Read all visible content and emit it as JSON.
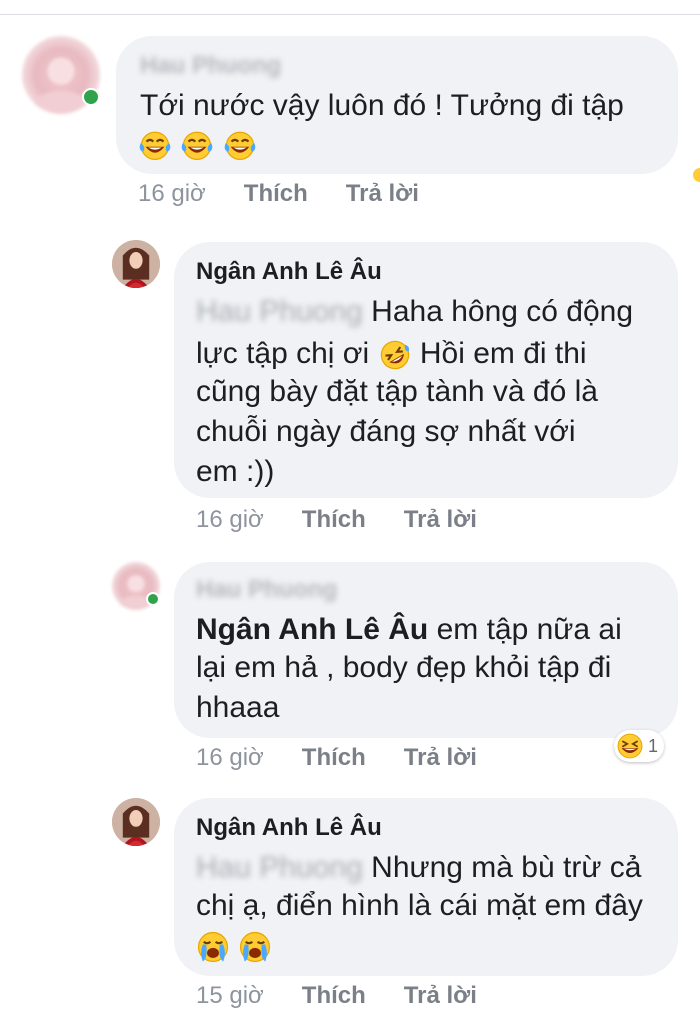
{
  "comments": [
    {
      "author": "Hau Phuong",
      "author_blurred": true,
      "lines": [
        "Tới nước vậy luôn đó ! Tưởng đi tập"
      ],
      "emoji_row": [
        "laughing-tears",
        "laughing-tears",
        "laughing-tears"
      ],
      "time": "16 giờ",
      "like": "Thích",
      "reply": "Trả lời"
    },
    {
      "author": "Ngân Anh Lê Âu",
      "tag": "Hau Phuong",
      "lines": [
        "Haha hông có động",
        "lực tập chị ơi",
        "Hồi em đi thi",
        "cũng bày đặt tập tành và đó là",
        "chuỗi ngày đáng sợ nhất với",
        "em :))"
      ],
      "time": "16 giờ",
      "like": "Thích",
      "reply": "Trả lời"
    },
    {
      "author": "Hau Phuong",
      "author_blurred": true,
      "tag": "Ngân Anh Lê Âu",
      "lines": [
        "em tập nữa ai",
        "lại em hả , body đẹp khỏi tập đi",
        "hhaaa"
      ],
      "time": "16 giờ",
      "like": "Thích",
      "reply": "Trả lời",
      "reaction": {
        "icon": "laughing-face",
        "count": "1"
      }
    },
    {
      "author": "Ngân Anh Lê Âu",
      "tag": "Hau Phuong",
      "lines": [
        "Nhưng mà bù trừ cả",
        "chị ạ, điển hình là cái mặt em đây"
      ],
      "emoji_row": [
        "crying-face",
        "crying-face"
      ],
      "time": "15 giờ",
      "like": "Thích",
      "reply": "Trả lời"
    }
  ],
  "colors": {
    "bubble": "#f0f2f5",
    "meta": "#8d949e",
    "online": "#31a24c"
  }
}
